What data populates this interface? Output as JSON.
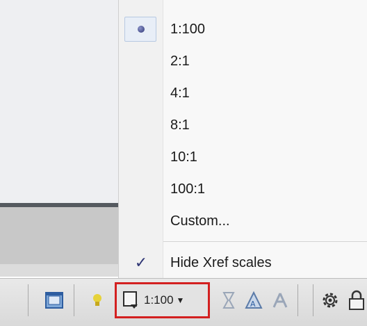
{
  "annotation_scale_menu": {
    "items": [
      {
        "label": "1:100",
        "selected": true
      },
      {
        "label": "2:1",
        "selected": false
      },
      {
        "label": "4:1",
        "selected": false
      },
      {
        "label": "8:1",
        "selected": false
      },
      {
        "label": "10:1",
        "selected": false
      },
      {
        "label": "100:1",
        "selected": false
      },
      {
        "label": "Custom...",
        "selected": false
      }
    ],
    "hide_xref": {
      "label": "Hide Xref scales",
      "checked": true
    }
  },
  "statusbar": {
    "annotation_scale_value": "1:100",
    "highlight_color": "#d32020",
    "icons": [
      "layout-viewport-icon",
      "lightbulb-icon",
      "annotation-scale-icon",
      "annotation-visibility-icon",
      "auto-scale-icon",
      "sync-scale-icon",
      "gear-icon",
      "lock-icon"
    ]
  }
}
